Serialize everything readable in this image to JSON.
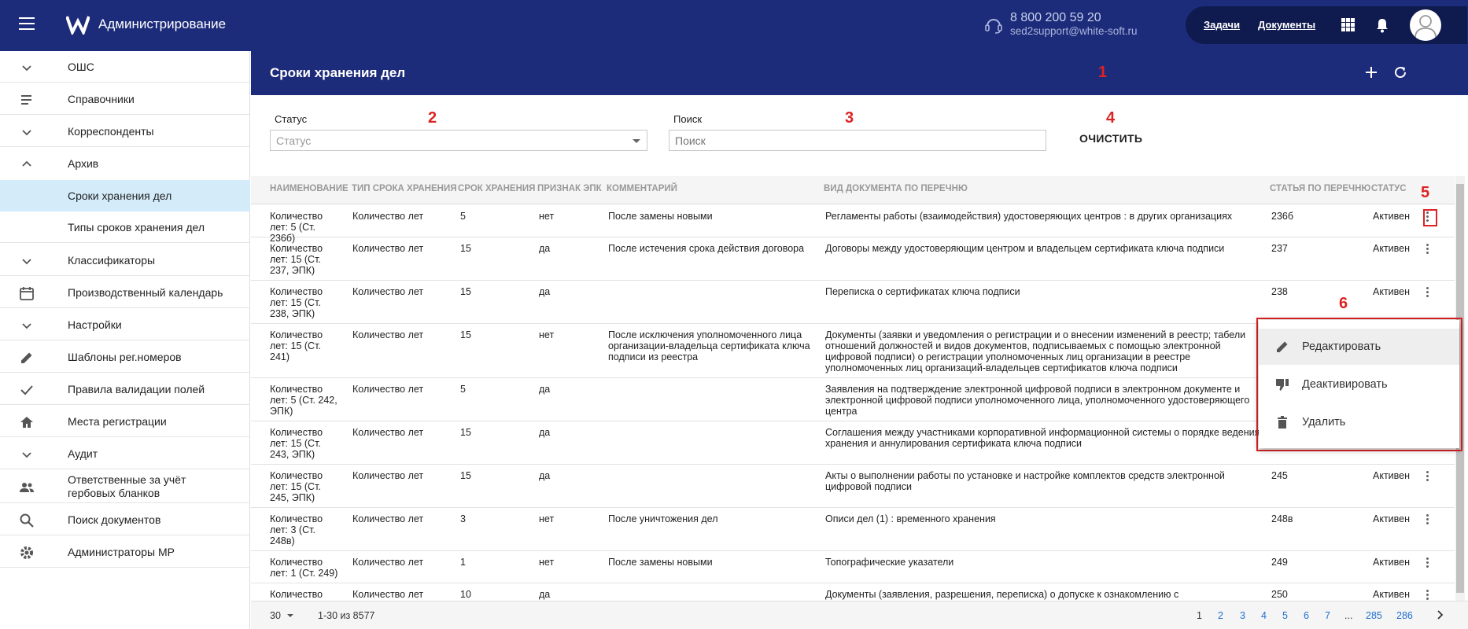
{
  "header": {
    "app_title": "Администрирование",
    "phone": "8 800 200 59 20",
    "email": "sed2support@white-soft.ru",
    "links": [
      "Задачи",
      "Документы"
    ]
  },
  "sidebar": {
    "items": [
      {
        "label": "ОШС",
        "icon": "chevron-down-icon"
      },
      {
        "label": "Справочники",
        "icon": "list-icon"
      },
      {
        "label": "Корреспонденты",
        "icon": "chevron-down-icon"
      },
      {
        "label": "Архив",
        "icon": "chevron-up-icon"
      },
      {
        "label": "Сроки хранения дел",
        "icon": "",
        "sub": true,
        "active": true
      },
      {
        "label": "Типы сроков хранения дел",
        "icon": "",
        "sub": true
      },
      {
        "label": "Классификаторы",
        "icon": "chevron-down-icon"
      },
      {
        "label": "Производственный календарь",
        "icon": "calendar-icon"
      },
      {
        "label": "Настройки",
        "icon": "chevron-down-icon"
      },
      {
        "label": "Шаблоны рег.номеров",
        "icon": "pencil-icon"
      },
      {
        "label": "Правила валидации полей",
        "icon": "check-icon"
      },
      {
        "label": "Места регистрации",
        "icon": "home-icon"
      },
      {
        "label": "Аудит",
        "icon": "chevron-down-icon"
      },
      {
        "label": "Ответственные за учёт гербовых бланков",
        "icon": "people-icon"
      },
      {
        "label": "Поиск документов",
        "icon": "search-icon"
      },
      {
        "label": "Администраторы МР",
        "icon": "gear-icon"
      }
    ]
  },
  "main": {
    "title": "Сроки хранения дел",
    "markers": [
      "1",
      "2",
      "3",
      "4",
      "5",
      "6"
    ],
    "filters": {
      "status_label": "Статус",
      "status_placeholder": "Статус",
      "search_label": "Поиск",
      "search_placeholder": "Поиск",
      "clear_label": "ОЧИСТИТЬ"
    },
    "table": {
      "columns": [
        "НАИМЕНОВАНИЕ",
        "ТИП СРОКА ХРАНЕНИЯ",
        "СРОК ХРАНЕНИЯ",
        "ПРИЗНАК ЭПК",
        "КОММЕНТАРИЙ",
        "ВИД ДОКУМЕНТА ПО ПЕРЕЧНЮ",
        "СТАТЬЯ ПО ПЕРЕЧНЮ",
        "СТАТУС"
      ],
      "rows": [
        {
          "name": "Количество лет: 5 (Ст. 236б)",
          "type": "Количество лет",
          "term": "5",
          "epk": "нет",
          "comment": "После замены новыми",
          "doc": "Регламенты работы (взаимодействия) удостоверяющих центров : в других организациях",
          "article": "236б",
          "status": "Активен"
        },
        {
          "name": "Количество лет: 15 (Ст. 237, ЭПК)",
          "type": "Количество лет",
          "term": "15",
          "epk": "да",
          "comment": "После истечения срока действия договора",
          "doc": "Договоры между удостоверяющим центром и владельцем сертификата ключа подписи",
          "article": "237",
          "status": "Активен"
        },
        {
          "name": "Количество лет: 15 (Ст. 238, ЭПК)",
          "type": "Количество лет",
          "term": "15",
          "epk": "да",
          "comment": "",
          "doc": "Переписка о сертификатах ключа подписи",
          "article": "238",
          "status": "Активен"
        },
        {
          "name": "Количество лет: 15 (Ст. 241)",
          "type": "Количество лет",
          "term": "15",
          "epk": "нет",
          "comment": "После исключения уполномоченного лица организации-владельца сертификата ключа подписи из реестра",
          "doc": "Документы (заявки и уведомления о регистрации и о внесении изменений в реестр; табели отношений должностей и видов документов, подписываемых с помощью электронной цифровой подписи) о регистрации уполномоченных лиц организации в реестре уполномоченных лиц организаций-владельцев сертификатов ключа подписи",
          "article": "",
          "status": ""
        },
        {
          "name": "Количество лет: 5 (Ст. 242, ЭПК)",
          "type": "Количество лет",
          "term": "5",
          "epk": "да",
          "comment": "",
          "doc": "Заявления на подтверждение электронной цифровой подписи в электронном документе и электронной цифровой подписи уполномоченного лица, уполномоченного удостоверяющего центра",
          "article": "",
          "status": ""
        },
        {
          "name": "Количество лет: 15 (Ст. 243, ЭПК)",
          "type": "Количество лет",
          "term": "15",
          "epk": "да",
          "comment": "",
          "doc": "Соглашения между участниками корпоративной информационной системы о порядке ведения, хранения и аннулирования сертификата ключа подписи",
          "article": "",
          "status": ""
        },
        {
          "name": "Количество лет: 15 (Ст. 245, ЭПК)",
          "type": "Количество лет",
          "term": "15",
          "epk": "да",
          "comment": "",
          "doc": "Акты о выполнении работы по установке и настройке комплектов средств электронной цифровой подписи",
          "article": "245",
          "status": "Активен"
        },
        {
          "name": "Количество лет: 3 (Ст. 248в)",
          "type": "Количество лет",
          "term": "3",
          "epk": "нет",
          "comment": "После уничтожения дел",
          "doc": "Описи дел (1) : временного хранения",
          "article": "248в",
          "status": "Активен"
        },
        {
          "name": "Количество лет: 1 (Ст. 249)",
          "type": "Количество лет",
          "term": "1",
          "epk": "нет",
          "comment": "После замены новыми",
          "doc": "Топографические указатели",
          "article": "249",
          "status": "Активен"
        },
        {
          "name": "Количество",
          "type": "Количество лет",
          "term": "10",
          "epk": "да",
          "comment": "",
          "doc": "Документы (заявления, разрешения, переписка) о допуске к ознакомлению с",
          "article": "250",
          "status": "Активен"
        }
      ]
    },
    "context_menu": [
      "Редактировать",
      "Деактивировать",
      "Удалить"
    ],
    "footer": {
      "page_size": "30",
      "range": "1-30 из 8577",
      "pages": [
        "1",
        "2",
        "3",
        "4",
        "5",
        "6",
        "7",
        "...",
        "285",
        "286"
      ]
    }
  }
}
